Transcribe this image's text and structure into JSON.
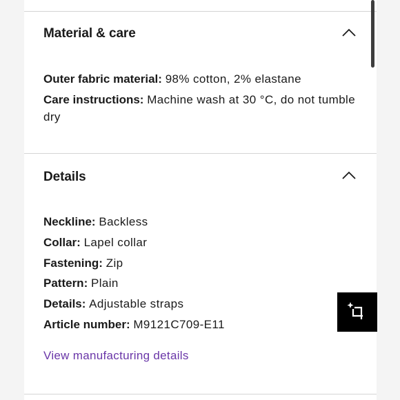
{
  "material_care": {
    "title": "Material & care",
    "outer_fabric_label": "Outer fabric material:",
    "outer_fabric_value": "98% cotton, 2% elastane",
    "care_label": "Care instructions:",
    "care_value": "Machine wash at 30 °C, do not tumble dry"
  },
  "details": {
    "title": "Details",
    "rows": [
      {
        "label": "Neckline:",
        "value": "Backless"
      },
      {
        "label": "Collar:",
        "value": "Lapel collar"
      },
      {
        "label": "Fastening:",
        "value": "Zip"
      },
      {
        "label": "Pattern:",
        "value": "Plain"
      },
      {
        "label": "Details:",
        "value": "Adjustable straps"
      },
      {
        "label": "Article number:",
        "value": "M9121C709-E11"
      }
    ],
    "manufacturing_link": "View manufacturing details"
  },
  "icons": {
    "collapse_icon": "chevron-up-icon",
    "floating_button_icon": "crop-sparkle-icon"
  },
  "colors": {
    "link": "#6a36a8",
    "float_button_bg": "#000000"
  }
}
